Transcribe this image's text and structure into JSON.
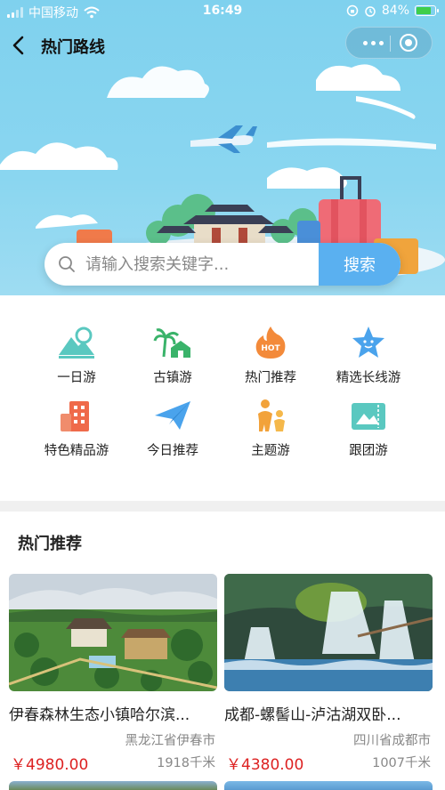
{
  "status_bar": {
    "carrier": "中国移动",
    "time": "16:49",
    "battery": "84%"
  },
  "nav": {
    "title": "热门路线"
  },
  "search": {
    "placeholder": "请输入搜索关键字...",
    "button_label": "搜索"
  },
  "categories": [
    {
      "label": "一日游",
      "icon": "mountain-icon"
    },
    {
      "label": "古镇游",
      "icon": "palm-house-icon"
    },
    {
      "label": "热门推荐",
      "icon": "hot-icon"
    },
    {
      "label": "精选长线游",
      "icon": "star-icon"
    },
    {
      "label": "特色精品游",
      "icon": "building-icon"
    },
    {
      "label": "今日推荐",
      "icon": "paper-plane-icon"
    },
    {
      "label": "主题游",
      "icon": "family-icon"
    },
    {
      "label": "跟团游",
      "icon": "ticket-icon"
    }
  ],
  "section": {
    "title": "热门推荐"
  },
  "cards": [
    {
      "name": "伊春森林生态小镇哈尔滨...",
      "location": "黑龙江省伊春市",
      "price": "￥4980.00",
      "distance": "1918千米"
    },
    {
      "name": "成都-螺髻山-泸沽湖双卧...",
      "location": "四川省成都市",
      "price": "￥4380.00",
      "distance": "1007千米"
    }
  ],
  "colors": {
    "accent": "#5ab0f0",
    "price": "#dd2222",
    "sky": "#7fd1ee"
  }
}
